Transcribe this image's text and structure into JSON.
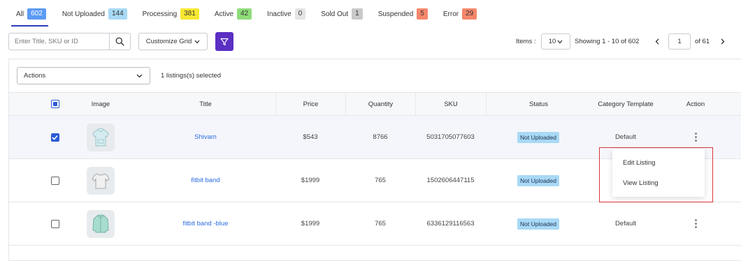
{
  "tabs": [
    {
      "label": "All",
      "count": "602",
      "color": "#5b9bf5",
      "active": true
    },
    {
      "label": "Not Uploaded",
      "count": "144",
      "color": "#a8d9f5"
    },
    {
      "label": "Processing",
      "count": "381",
      "color": "#f7e830"
    },
    {
      "label": "Active",
      "count": "42",
      "color": "#8fdc7a"
    },
    {
      "label": "Inactive",
      "count": "0",
      "color": "#e4e4e4"
    },
    {
      "label": "Sold Out",
      "count": "1",
      "color": "#c9c9c9"
    },
    {
      "label": "Suspended",
      "count": "5",
      "color": "#f5876a"
    },
    {
      "label": "Error",
      "count": "29",
      "color": "#f5876a"
    }
  ],
  "toolbar": {
    "search_placeholder": "Enter Title, SKU or ID",
    "customize_grid_label": "Customize Grid",
    "items_label": "Items :",
    "items_per_page": "10",
    "showing_text": "Showing 1 - 10 of 602",
    "current_page": "1",
    "page_of_text": "of 61"
  },
  "bulk": {
    "actions_label": "Actions",
    "selected_text": "1 listings(s) selected"
  },
  "columns": {
    "image": "Image",
    "title": "Title",
    "price": "Price",
    "quantity": "Quantity",
    "sku": "SKU",
    "status": "Status",
    "category_template": "Category Template",
    "action": "Action"
  },
  "rows": [
    {
      "title": "Shivam",
      "price": "$543",
      "quantity": "8766",
      "sku": "5031705077603",
      "status": "Not Uploaded",
      "template": "Default",
      "checked": true,
      "image_icon": "hoodie-icon"
    },
    {
      "title": "fitbit band",
      "price": "$1999",
      "quantity": "765",
      "sku": "1502606447115",
      "status": "Not Uploaded",
      "template": "",
      "checked": false,
      "image_icon": "tshirt-icon"
    },
    {
      "title": "fitbit band -blue",
      "price": "$1999",
      "quantity": "765",
      "sku": "6336129116563",
      "status": "Not Uploaded",
      "template": "Default",
      "checked": false,
      "image_icon": "jacket-icon"
    }
  ],
  "action_menu": {
    "items": [
      "Edit Listing",
      "View Listing"
    ]
  },
  "colors": {
    "accent": "#2c3fb8",
    "filter_button": "#5a2fc2",
    "link": "#2b6de0",
    "status_not_uploaded": "#a8d9f5",
    "highlight_border": "#d9363e"
  }
}
